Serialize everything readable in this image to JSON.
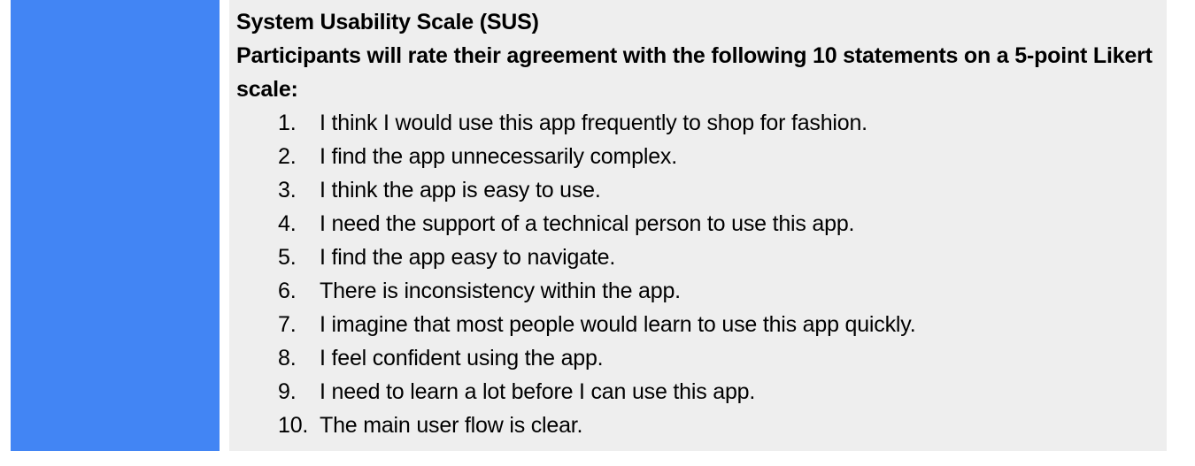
{
  "colors": {
    "accent_bar": "#4285f4",
    "panel_background": "#eeeeee",
    "text": "#000000"
  },
  "section": {
    "title": "System Usability Scale (SUS)",
    "intro": "Participants will rate their agreement with the following 10 statements on a 5-point Likert scale:",
    "statements": [
      {
        "number": "1.",
        "text": "I think I would use this app frequently to shop for fashion."
      },
      {
        "number": "2.",
        "text": "I find the app unnecessarily complex."
      },
      {
        "number": "3.",
        "text": "I think the app is easy to use."
      },
      {
        "number": "4.",
        "text": "I need the support of a technical person to use this app."
      },
      {
        "number": "5.",
        "text": "I find the app easy to navigate."
      },
      {
        "number": "6.",
        "text": "There is inconsistency within the app."
      },
      {
        "number": "7.",
        "text": "I imagine that most people would learn to use this app quickly."
      },
      {
        "number": "8.",
        "text": "I feel confident using the app."
      },
      {
        "number": "9.",
        "text": "I need to learn a lot before I can use this app."
      },
      {
        "number": "10.",
        "text": "The main user flow is clear."
      }
    ]
  }
}
